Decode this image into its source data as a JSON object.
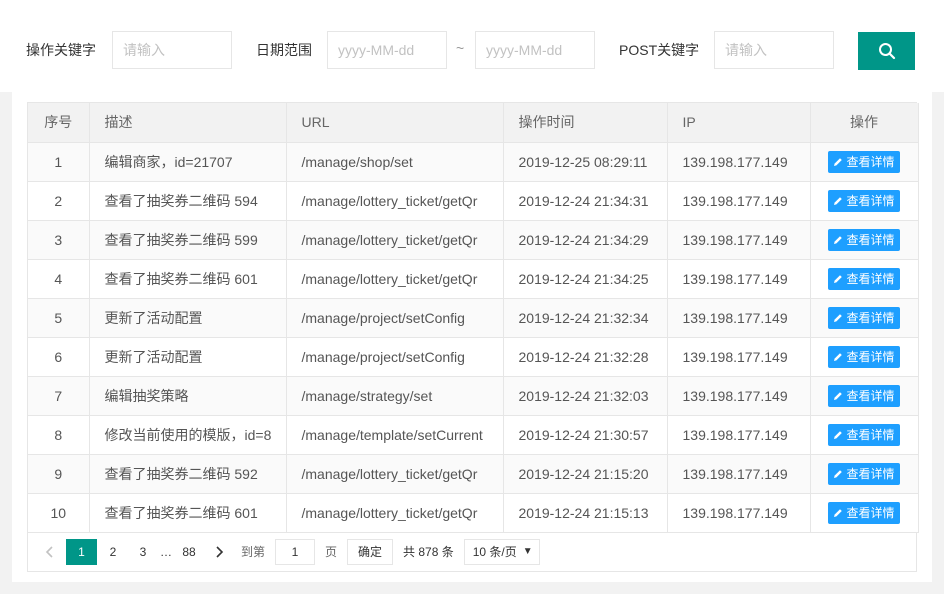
{
  "search": {
    "keyword_label": "操作关键字",
    "keyword_placeholder": "请输入",
    "date_label": "日期范围",
    "date_start_placeholder": "yyyy-MM-dd",
    "date_separator": "~",
    "date_end_placeholder": "yyyy-MM-dd",
    "post_label": "POST关键字",
    "post_placeholder": "请输入",
    "search_icon": "search-icon",
    "accent_color": "#009688"
  },
  "table": {
    "headers": [
      "序号",
      "描述",
      "URL",
      "操作时间",
      "IP",
      "操作"
    ],
    "detail_label": "查看详情",
    "detail_icon": "edit-icon",
    "button_color": "#1E9FFF",
    "rows": [
      {
        "no": "1",
        "desc": "编辑商家，id=21707",
        "url": "/manage/shop/set",
        "time": "2019-12-25 08:29:11",
        "ip": "139.198.177.149"
      },
      {
        "no": "2",
        "desc": "查看了抽奖券二维码 594",
        "url": "/manage/lottery_ticket/getQr",
        "time": "2019-12-24 21:34:31",
        "ip": "139.198.177.149"
      },
      {
        "no": "3",
        "desc": "查看了抽奖券二维码 599",
        "url": "/manage/lottery_ticket/getQr",
        "time": "2019-12-24 21:34:29",
        "ip": "139.198.177.149"
      },
      {
        "no": "4",
        "desc": "查看了抽奖券二维码 601",
        "url": "/manage/lottery_ticket/getQr",
        "time": "2019-12-24 21:34:25",
        "ip": "139.198.177.149"
      },
      {
        "no": "5",
        "desc": "更新了活动配置",
        "url": "/manage/project/setConfig",
        "time": "2019-12-24 21:32:34",
        "ip": "139.198.177.149"
      },
      {
        "no": "6",
        "desc": "更新了活动配置",
        "url": "/manage/project/setConfig",
        "time": "2019-12-24 21:32:28",
        "ip": "139.198.177.149"
      },
      {
        "no": "7",
        "desc": "编辑抽奖策略",
        "url": "/manage/strategy/set",
        "time": "2019-12-24 21:32:03",
        "ip": "139.198.177.149"
      },
      {
        "no": "8",
        "desc": "修改当前使用的模版，id=8",
        "url": "/manage/template/setCurrent",
        "time": "2019-12-24 21:30:57",
        "ip": "139.198.177.149"
      },
      {
        "no": "9",
        "desc": "查看了抽奖券二维码 592",
        "url": "/manage/lottery_ticket/getQr",
        "time": "2019-12-24 21:15:20",
        "ip": "139.198.177.149"
      },
      {
        "no": "10",
        "desc": "查看了抽奖券二维码 601",
        "url": "/manage/lottery_ticket/getQr",
        "time": "2019-12-24 21:15:13",
        "ip": "139.198.177.149"
      }
    ]
  },
  "pager": {
    "prev_icon": "chevron-left-icon",
    "pages": [
      "1",
      "2",
      "3"
    ],
    "ellipsis": "…",
    "last_page": "88",
    "next_icon": "chevron-right-icon",
    "jump_label": "到第",
    "jump_value": "1",
    "page_unit": "页",
    "confirm_label": "确定",
    "total_text": "共 878 条",
    "page_size": "10 条/页",
    "active_color": "#009688"
  }
}
